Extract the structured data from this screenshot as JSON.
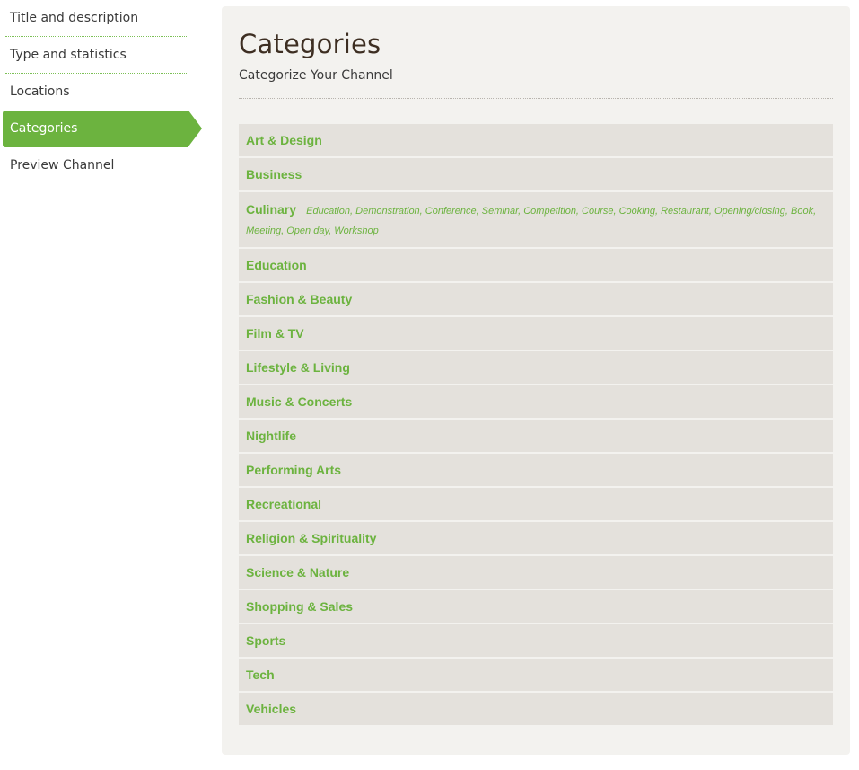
{
  "sidebar": {
    "items": [
      {
        "label": "Title and description"
      },
      {
        "label": "Type and statistics"
      },
      {
        "label": "Locations"
      },
      {
        "label": "Categories"
      },
      {
        "label": "Preview Channel"
      }
    ]
  },
  "main": {
    "title": "Categories",
    "subtitle": "Categorize Your Channel",
    "categories": [
      {
        "name": "Art & Design"
      },
      {
        "name": "Business"
      },
      {
        "name": "Culinary",
        "subcategories": "Education, Demonstration, Conference, Seminar, Competition, Course, Cooking, Restaurant, Opening/closing, Book, Meeting, Open day, Workshop"
      },
      {
        "name": "Education"
      },
      {
        "name": "Fashion & Beauty"
      },
      {
        "name": "Film & TV"
      },
      {
        "name": "Lifestyle & Living"
      },
      {
        "name": "Music & Concerts"
      },
      {
        "name": "Nightlife"
      },
      {
        "name": "Performing Arts"
      },
      {
        "name": "Recreational"
      },
      {
        "name": "Religion & Spirituality"
      },
      {
        "name": "Science & Nature"
      },
      {
        "name": "Shopping & Sales"
      },
      {
        "name": "Sports"
      },
      {
        "name": "Tech"
      },
      {
        "name": "Vehicles"
      }
    ]
  },
  "colors": {
    "accent": "#6cb33f",
    "panel_background": "#f3f2ef",
    "row_background": "#e4e1dc",
    "title": "#3d2e22"
  }
}
